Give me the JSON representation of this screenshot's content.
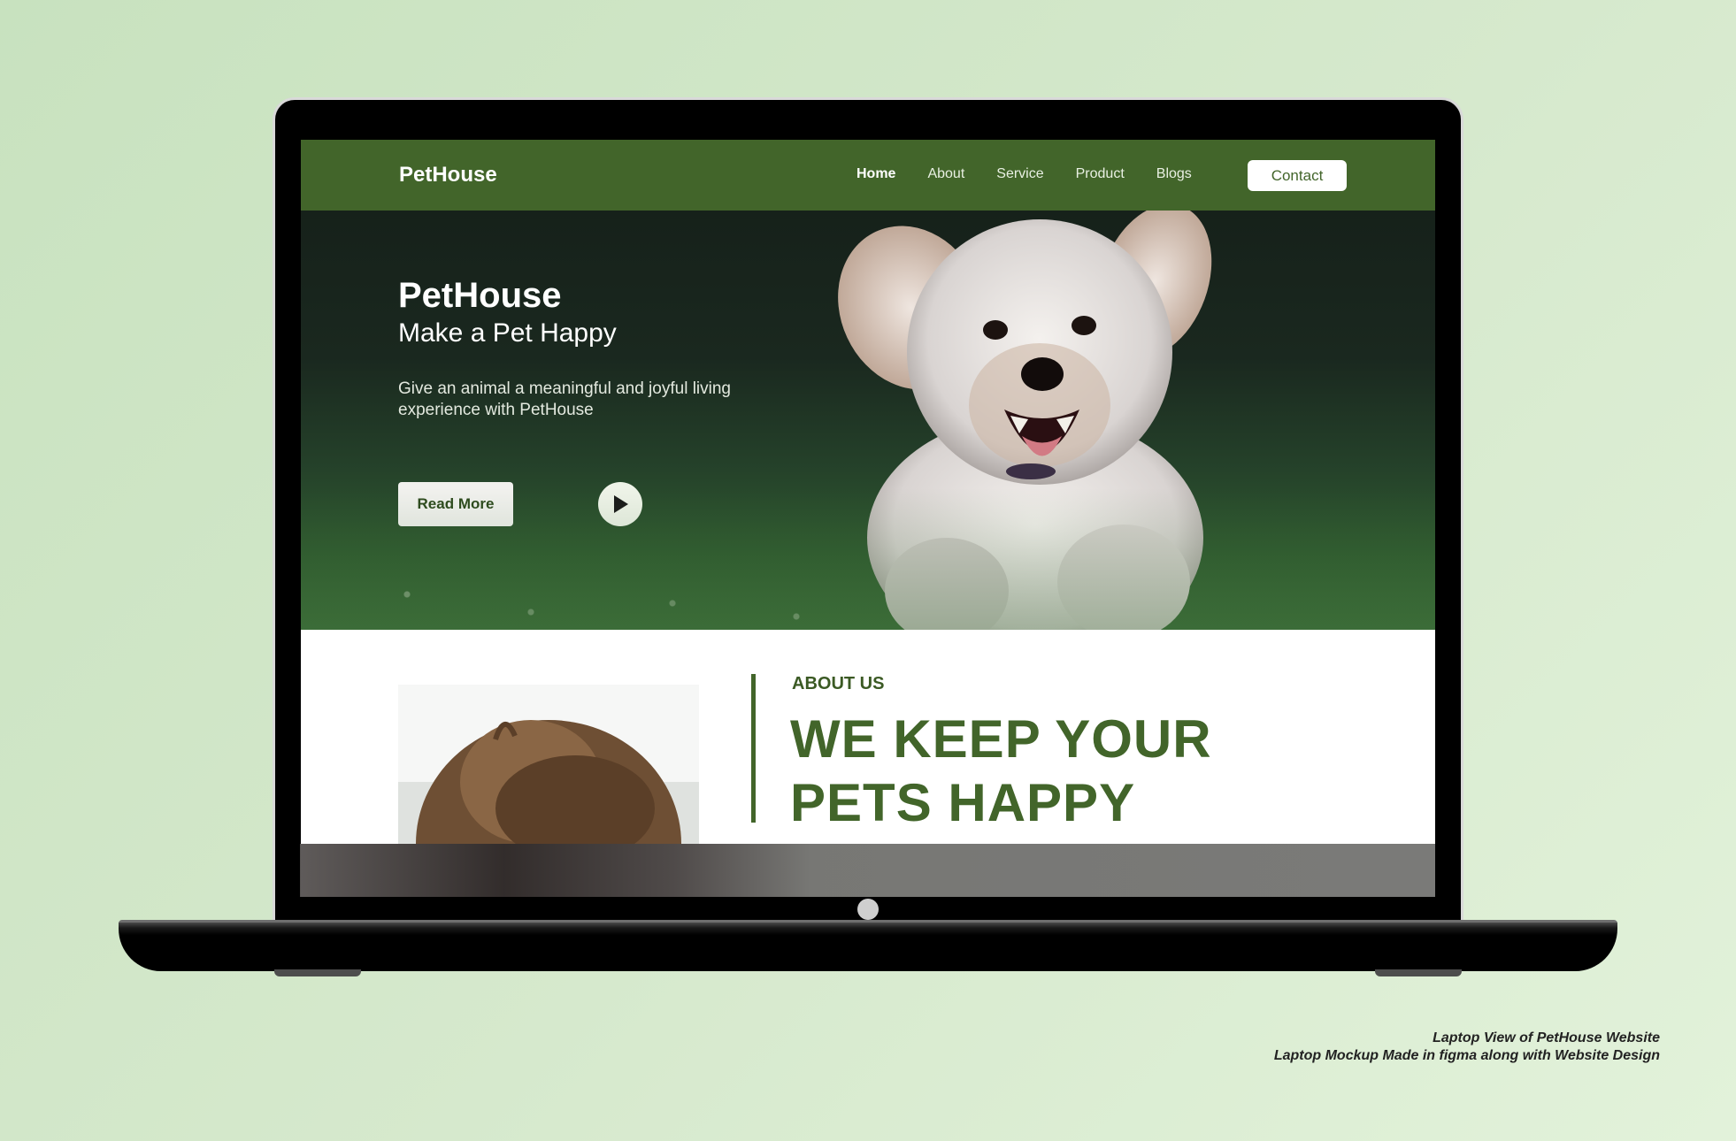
{
  "nav": {
    "brand": "PetHouse",
    "links": [
      {
        "label": "Home",
        "active": true
      },
      {
        "label": "About"
      },
      {
        "label": "Service"
      },
      {
        "label": "Product"
      },
      {
        "label": "Blogs"
      }
    ],
    "contact_label": "Contact"
  },
  "hero": {
    "title": "PetHouse",
    "subtitle": "Make a Pet Happy",
    "description": "Give an animal a meaningful and joyful living experience with PetHouse",
    "read_more_label": "Read More",
    "play_icon": "play-icon"
  },
  "about": {
    "kicker": "ABOUT US",
    "heading_line1": "WE KEEP YOUR",
    "heading_line2": "PETS HAPPY"
  },
  "caption": {
    "line1": "Laptop View of PetHouse Website",
    "line2": "Laptop Mockup Made in figma along with Website Design"
  },
  "colors": {
    "brand_green": "#42652a",
    "background": "#cfe5c6"
  }
}
